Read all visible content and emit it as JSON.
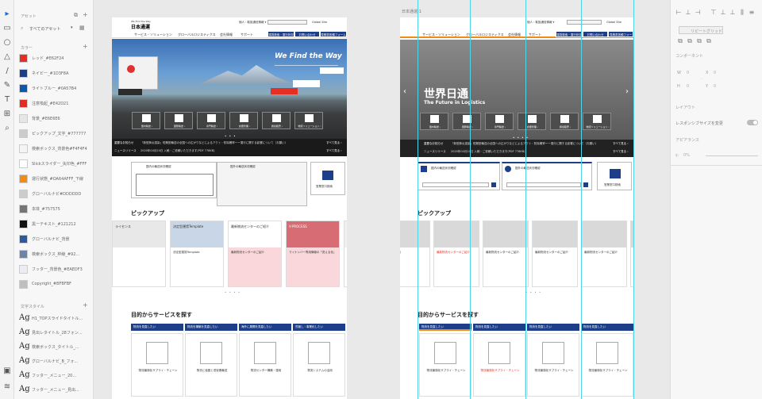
{
  "assets": {
    "header": "アセット",
    "filter": "すべてのアセット",
    "colors_header": "カラー",
    "colors": [
      {
        "name": "レッド_#E62F24",
        "hex": "#e62f24"
      },
      {
        "name": "ネイビー_#1D3F8A",
        "hex": "#1d3f8a"
      },
      {
        "name": "ライトブルー_#0A57B4",
        "hex": "#0a57b4"
      },
      {
        "name": "注意喚起_#E42D21",
        "hex": "#e42d21"
      },
      {
        "name": "背景_#E6E6E6",
        "hex": "#e6e6e6"
      },
      {
        "name": "ピックアップ_文字_#777777",
        "hex": "#cccccc"
      },
      {
        "name": "検索ボックス_背景色#F4F4F4",
        "hex": "#f4f4f4"
      },
      {
        "name": "Slickスライダー_矢印色_#FFF",
        "hex": "#ffffff"
      },
      {
        "name": "運行状態_#OA64AFFF_下線",
        "hex": "#f28a16"
      },
      {
        "name": "グローバルナビ#DDDDDD",
        "hex": "#cccccc"
      },
      {
        "name": "本体_#757575",
        "hex": "#757575"
      },
      {
        "name": "黒ーテキスト_#121212",
        "hex": "#121212"
      },
      {
        "name": "グローバルナビ_背景",
        "hex": "#2c5aa0"
      },
      {
        "name": "検索ボックス_枠線_#92...",
        "hex": "#6e83a8"
      },
      {
        "name": "フッター_背景色_#EAEDF3",
        "hex": "#eaedf3"
      },
      {
        "name": "Copyright_#BFBFBF",
        "hex": "#bfbfbf"
      }
    ],
    "char_styles_header": "文字スタイル",
    "char_styles": [
      "H1_TOPスライドタイトル...",
      "見出レタイトル_28フォン...",
      "検索ボックス_タイトル_...",
      "グローバルナビ_B_フォ...",
      "フッター_メニュー_20...",
      "フッター_メニュー_見出..."
    ],
    "ag_label": "Ag"
  },
  "canvas": {
    "artboard_left": {
      "logo_text": "日本通運",
      "logo_sub": "We Find the Way",
      "nav_items": [
        "サービス・ソリューション",
        "グローバルロジスティクス",
        "会社情報",
        "サポート"
      ],
      "top_links": [
        "個人・取扱通信情報 ▾",
        "Global Site"
      ],
      "blue_buttons": [
        "運賃検索・運行状況",
        "お問い合わせ",
        "見積書依頼フォーム"
      ],
      "hero_slogan": "We Find the Way",
      "hero_tiles": [
        "国内輸送 ›",
        "国際輸送 ›",
        "専門輸送 ›",
        "倉庫管理 ›",
        "調達販売 ›",
        "物流ソリューション ›"
      ],
      "news_label": "重要なお知らせ",
      "news_text": "「新型肺炎感染」短期型輸送の全国への広がりなどによるアクト・防除確率ーー運行に関する影響について（お願い）",
      "news2_label": "ニュースリリース",
      "news2_text": "2020年04月24日 入稿・ご依頼いただきます(PDF 776KB)",
      "more": "すべて見る ›",
      "search_left": "国内の輸送状況確認",
      "search_right": "国外の輸送状況確認",
      "search_third": "営業窓口検索",
      "pickup": "ピックアップ",
      "pickup_cards": [
        "ライセンス",
        "決定型運賃Template",
        "最新物流センターのご紹介",
        "V-PROCESS",
        "Tokyo C-BOX"
      ],
      "pickup_card_text": [
        "",
        "決定型運賃Template",
        "最新物流センターのご紹介",
        "マイナンバー専用情報の「見える化」",
        ""
      ],
      "vprocess_sub": "見える化",
      "purpose": "目的からサービスを探す",
      "purpose_heads": [
        "物流を見直したい",
        "物流を構築を見直したい",
        "海外に展開を見直したい",
        "究極し・事業化したい"
      ],
      "purpose_titles": [
        "物流最適化サプライ・チェーン",
        "物流に強固と低炭素輸送",
        "物流センター構築・運用",
        "物流システムの活用"
      ]
    },
    "artboard_right": {
      "title": "日本通運-1",
      "nav_items": [
        "サービス・ソリューション",
        "グローバルロジスティクス",
        "会社情報",
        "サポート"
      ],
      "top_links": [
        "個人・取扱通信情報 ▾",
        "Global Site"
      ],
      "blue_buttons": [
        "運賃検索・運行状況",
        "お問い合わせ",
        "見積書依頼フォーム"
      ],
      "hero_title": "世界日通",
      "hero_sub": "The Future in Logistics",
      "hero_tiles": [
        "国内輸送 ›",
        "国際輸送 ›",
        "専門輸送 ›",
        "倉庫管理 ›",
        "調達販売 ›",
        "物流ソリューション ›"
      ],
      "news_label": "重要なお知らせ",
      "news_text": "「新型肺炎感染」短期型輸送の全国への広がりなどによるアクト・防除確率ーー運行に関する影響について（お願い）",
      "news2_label": "ニュースリリース",
      "news2_text": "2020年04月24日 入稿・ご依頼いただきます(PDF 776KB)",
      "more": "すべて見る ›",
      "search_left": "国内の輸送状況確認",
      "search_right": "国外の輸送状況確認",
      "search_third": "営業窓口検索",
      "pickup": "ピックアップ",
      "pickup_cards": [
        "ライセンス",
        "最新物流センターのご紹介",
        "最新物流センターのご紹介",
        "最新物流センターのご紹介",
        "最新物流センターのご紹介",
        "ライセンス"
      ],
      "purpose": "目的からサービスを探す",
      "purpose_heads": [
        "物流を見直したい",
        "物流を見直したい",
        "物流を見直したい",
        "物流を見直したい"
      ],
      "purpose_titles": [
        "物流最適化サプライ・チェーン",
        "物流最適化サプライ・チェーン",
        "物流最適化サプライ・チェーン",
        "物流最適化サプライ・チェーン"
      ]
    }
  },
  "props": {
    "repeat_grid": "リピートグリッド",
    "component": "コンポーネント",
    "w_label": "W",
    "h_label": "H",
    "x_label": "X",
    "y_label": "Y",
    "w_val": "0",
    "h_val": "0",
    "x_val": "0",
    "y_val": "0",
    "layout": "レイアウト",
    "responsive": "レスポンシブサイズを変更",
    "appearance": "アピアランス",
    "opacity": "0%"
  }
}
